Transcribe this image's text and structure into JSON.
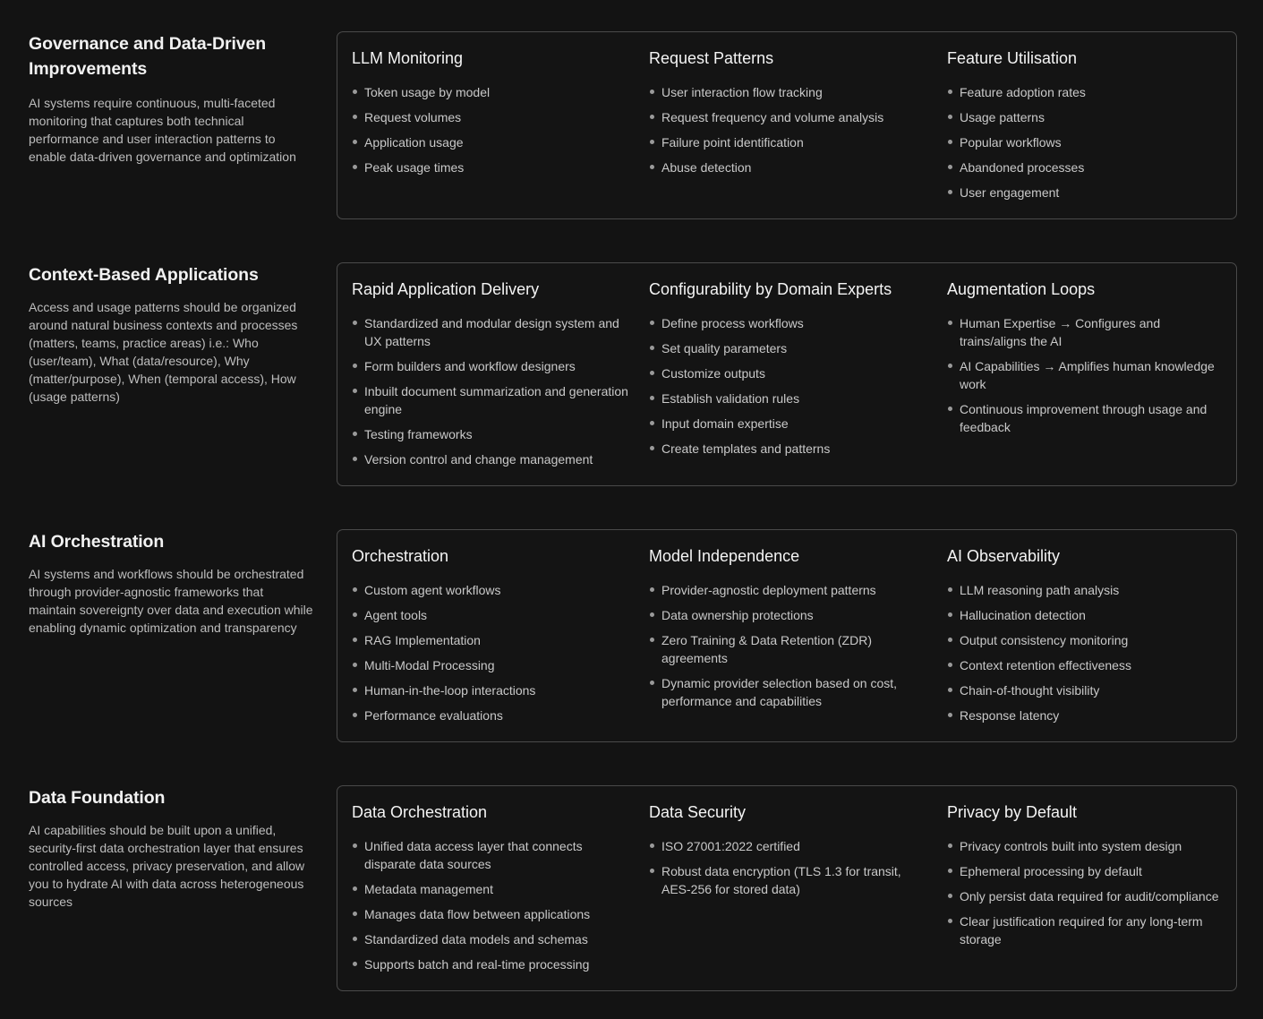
{
  "sections": [
    {
      "title": "Governance and Data-Driven Improvements",
      "description": "AI systems require continuous, multi-faceted monitoring that captures both technical performance and user interaction patterns to enable data-driven governance and optimization",
      "columns": [
        {
          "title": "LLM Monitoring",
          "items": [
            "Token usage by model",
            "Request volumes",
            "Application usage",
            "Peak usage times"
          ]
        },
        {
          "title": "Request Patterns",
          "items": [
            "User interaction flow tracking",
            "Request frequency and volume analysis",
            "Failure point identification",
            "Abuse detection"
          ]
        },
        {
          "title": "Feature Utilisation",
          "items": [
            "Feature adoption rates",
            "Usage patterns",
            "Popular workflows",
            "Abandoned processes",
            "User engagement"
          ]
        }
      ]
    },
    {
      "title": "Context-Based Applications",
      "description": "Access and usage patterns should be organized around natural business contexts and processes (matters, teams, practice areas) i.e.: Who (user/team), What (data/resource), Why (matter/purpose), When (temporal access), How (usage patterns)",
      "columns": [
        {
          "title": "Rapid Application Delivery",
          "items": [
            "Standardized and modular design system and UX patterns",
            "Form builders and workflow designers",
            "Inbuilt document summarization and generation engine",
            "Testing frameworks",
            "Version control and change management"
          ]
        },
        {
          "title": "Configurability by Domain Experts",
          "items": [
            "Define process workflows",
            "Set quality parameters",
            "Customize outputs",
            "Establish validation rules",
            "Input domain expertise",
            "Create templates and patterns"
          ]
        },
        {
          "title": "Augmentation Loops",
          "items": [
            "Human Expertise → Configures and trains/aligns the AI",
            "AI Capabilities → Amplifies human knowledge work",
            "Continuous improvement through usage and feedback"
          ]
        }
      ]
    },
    {
      "title": "AI Orchestration",
      "description": "AI systems and workflows should be orchestrated through provider-agnostic frameworks that maintain sovereignty over data and execution while enabling dynamic optimization and transparency",
      "columns": [
        {
          "title": "Orchestration",
          "items": [
            "Custom agent workflows",
            "Agent tools",
            "RAG Implementation",
            "Multi-Modal Processing",
            "Human-in-the-loop interactions",
            "Performance evaluations"
          ]
        },
        {
          "title": "Model Independence",
          "items": [
            "Provider-agnostic deployment patterns",
            "Data ownership protections",
            "Zero Training & Data Retention (ZDR) agreements",
            "Dynamic provider selection based on cost, performance and capabilities"
          ]
        },
        {
          "title": "AI Observability",
          "items": [
            "LLM reasoning path analysis",
            "Hallucination detection",
            "Output consistency monitoring",
            "Context retention effectiveness",
            "Chain-of-thought visibility",
            "Response latency"
          ]
        }
      ]
    },
    {
      "title": "Data Foundation",
      "description": "AI capabilities should be built upon a unified, security-first data orchestration layer that ensures controlled access, privacy preservation, and allow you to hydrate AI with data across heterogeneous sources",
      "columns": [
        {
          "title": "Data Orchestration",
          "items": [
            "Unified data access layer that connects disparate data sources",
            "Metadata management",
            "Manages data flow between applications",
            "Standardized data models and schemas",
            "Supports batch and real-time processing"
          ]
        },
        {
          "title": "Data Security",
          "items": [
            "ISO 27001:2022 certified",
            "Robust data encryption (TLS 1.3 for transit, AES-256 for stored data)"
          ]
        },
        {
          "title": "Privacy by Default",
          "items": [
            "Privacy controls built into system design",
            "Ephemeral processing by default",
            "Only persist data required for audit/compliance",
            "Clear justification required for any long-term storage"
          ]
        }
      ]
    }
  ]
}
